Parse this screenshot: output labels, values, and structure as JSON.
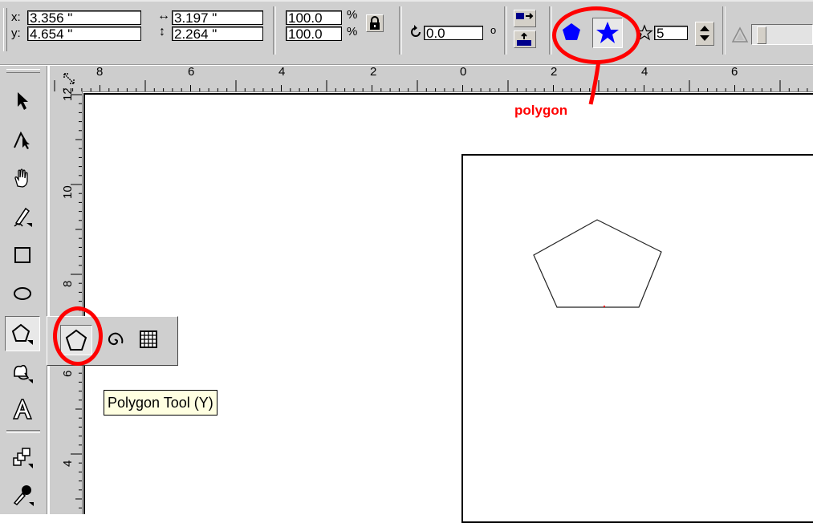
{
  "propbar": {
    "x_label": "x:",
    "x_value": "3.356 \"",
    "y_label": "y:",
    "y_value": "4.654 \"",
    "width_value": "3.197 \"",
    "height_value": "2.264 \"",
    "scale_x": "100.0",
    "scale_y": "100.0",
    "percent_symbol": "%",
    "rotation_value": "0.0",
    "degree_symbol": "o",
    "points_value": "5"
  },
  "rulers": {
    "top_ticks": [
      "8",
      "6",
      "4",
      "2",
      "0",
      "2",
      "4",
      "6"
    ],
    "left_ticks": [
      "12",
      "10",
      "8",
      "6",
      "4"
    ]
  },
  "tooltip": {
    "text": "Polygon Tool (Y)"
  },
  "annotation": {
    "callout": "polygon",
    "color": "#ff0000"
  },
  "colors": {
    "polygon_mode": "#0000ff",
    "star_mode": "#0000ff"
  }
}
